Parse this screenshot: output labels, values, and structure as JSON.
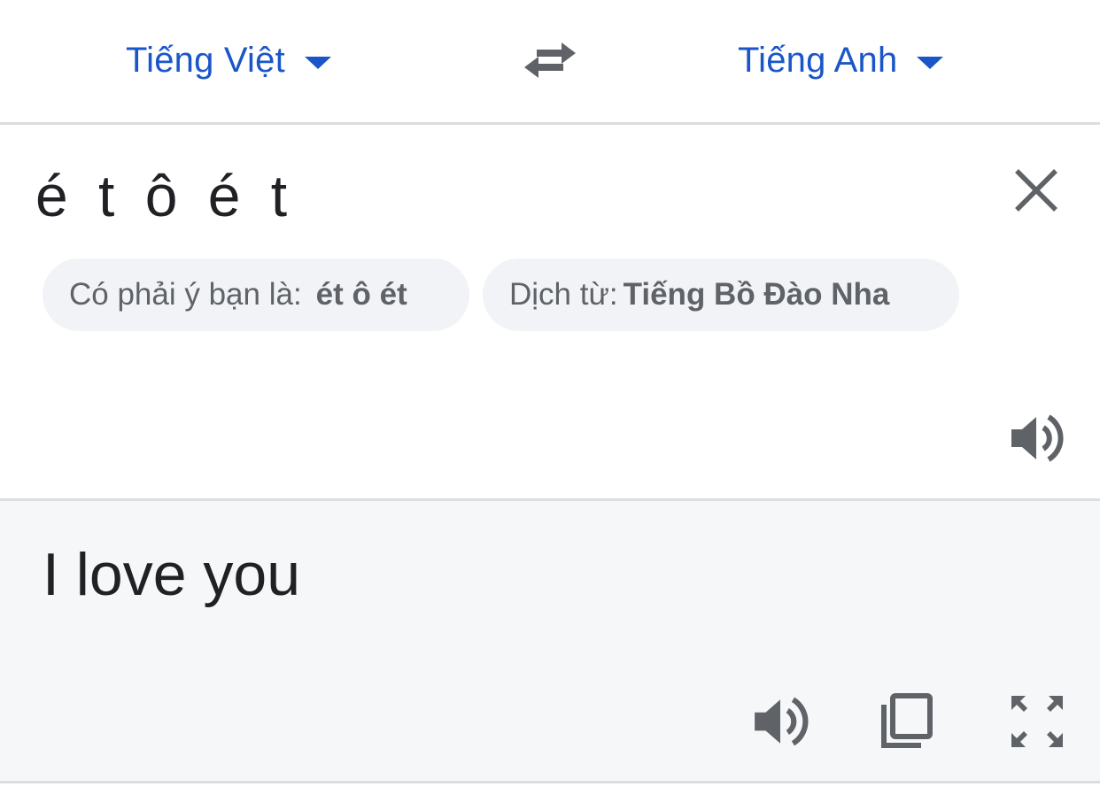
{
  "language_bar": {
    "source_language": "Tiếng Việt",
    "target_language": "Tiếng Anh",
    "swap_icon": "swap-arrows-icon",
    "dropdown_icon": "caret-down-icon"
  },
  "source": {
    "input_text": "é t ô é t",
    "clear_icon": "close-icon",
    "speaker_icon": "speaker-icon",
    "suggestion_chip": {
      "prefix": "Có phải ý bạn là:",
      "value": "ét ô ét"
    },
    "detect_chip": {
      "prefix": "Dịch từ:",
      "value": "Tiếng Bồ Đào Nha"
    }
  },
  "result": {
    "translated_text": "I love you",
    "speaker_icon": "speaker-icon",
    "copy_icon": "copy-icon",
    "fullscreen_icon": "fullscreen-icon"
  },
  "colors": {
    "accent_blue": "#1a56c8",
    "icon_gray": "#5f6368",
    "text_dark": "#202124",
    "chip_bg": "#f1f3f6",
    "result_bg": "#f6f7f9",
    "divider": "#dcdde0"
  }
}
